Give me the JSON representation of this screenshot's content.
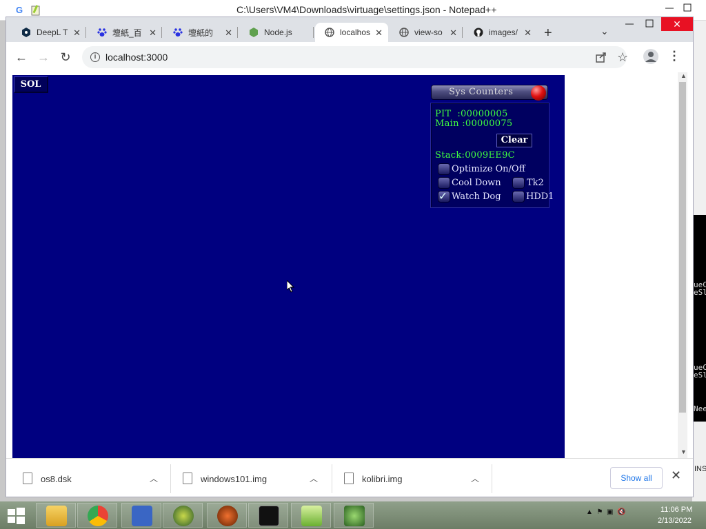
{
  "notepad": {
    "title": "C:\\Users\\VM4\\Downloads\\virtuage\\settings.json - Notepad++"
  },
  "browser": {
    "tabs": [
      {
        "label": "DeepL T",
        "icon": "deepl-icon"
      },
      {
        "label": "壇紙_百",
        "icon": "baidu-paw-icon"
      },
      {
        "label": "壇紙的",
        "icon": "baidu-paw-icon"
      },
      {
        "label": "Node.js",
        "icon": "nodejs-icon"
      },
      {
        "label": "localhos",
        "icon": "globe-icon",
        "active": true
      },
      {
        "label": "view-so",
        "icon": "globe-icon"
      },
      {
        "label": "images/",
        "icon": "github-icon"
      }
    ],
    "tab_close": "✕",
    "new_tab": "+",
    "url": "localhost:3000"
  },
  "emulator": {
    "sol_button": "SOL",
    "panel_title": "Sys Counters",
    "counters": [
      {
        "label": "PIT  :",
        "value": "00000005"
      },
      {
        "label": "Main :",
        "value": "00000075"
      }
    ],
    "clear_button": "Clear",
    "stack": "Stack:0009EE9C",
    "options": {
      "optimize": {
        "label": "Optimize On/Off",
        "checked": false
      },
      "cool_down": {
        "label": "Cool Down",
        "checked": false
      },
      "tk2": {
        "label": "Tk2",
        "checked": false
      },
      "watch_dog": {
        "label": "Watch Dog",
        "checked": true
      },
      "hdd1": {
        "label": "HDD1",
        "checked": false
      }
    },
    "colors": {
      "background": "#000080",
      "counter_text": "#40ff40"
    }
  },
  "downloads": {
    "items": [
      {
        "name": "os8.dsk"
      },
      {
        "name": "windows101.img"
      },
      {
        "name": "kolibri.img"
      }
    ],
    "show_all": "Show all",
    "close": "✕"
  },
  "background_app": {
    "lines": [
      "ueC",
      "eSl",
      "ueC",
      "eSl",
      "Nee"
    ],
    "status": "INS"
  },
  "taskbar": {
    "apps": [
      "file-explorer",
      "chrome",
      "app-3",
      "app-4",
      "app-5",
      "cmd",
      "notepad-plus-plus",
      "app-8"
    ],
    "time": "11:06 PM",
    "date": "2/13/2022"
  }
}
